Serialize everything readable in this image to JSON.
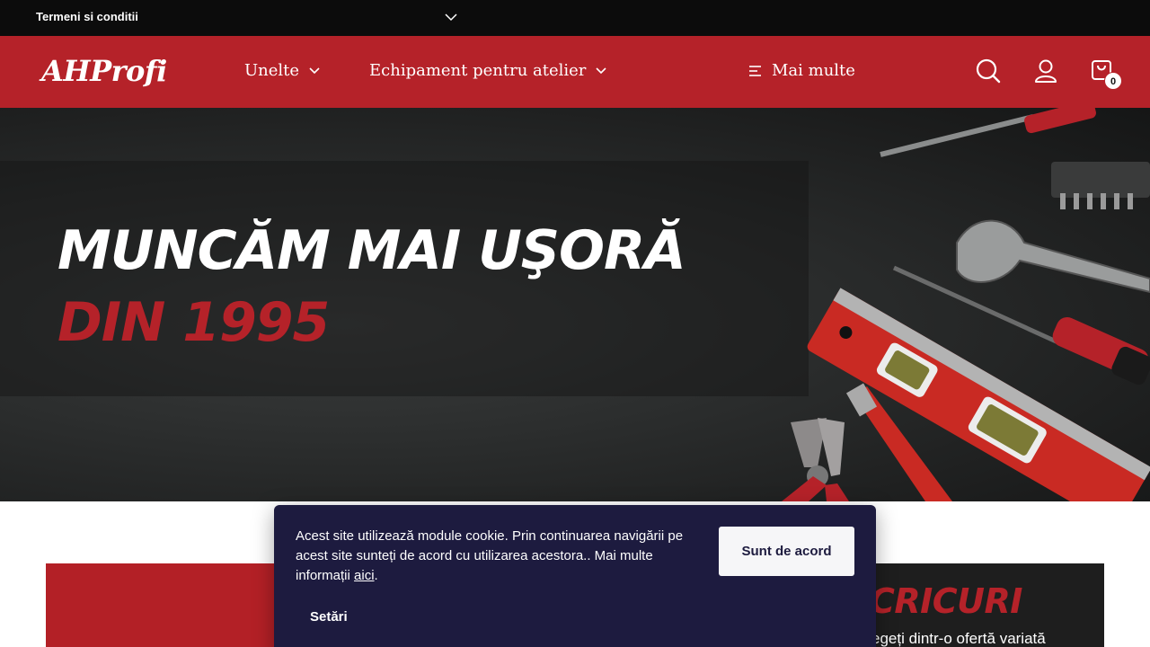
{
  "topbar": {
    "terms_label": "Termeni si conditii"
  },
  "header": {
    "logo": "AHProfi",
    "nav": [
      {
        "label": "Unelte"
      },
      {
        "label": "Echipament pentru atelier"
      },
      {
        "label": "Mai multe"
      }
    ],
    "cart_count": "0"
  },
  "hero": {
    "headline": "MUNCĂM MAI UŞORĂ",
    "subheadline": "DIN 1995"
  },
  "promo_right": {
    "title": "CRICURI",
    "subtitle": "egeți dintr-o ofertă variată"
  },
  "cookie": {
    "message": "Acest site utilizează module cookie. Prin continuarea navigării pe acest site sunteți de acord cu utilizarea acestora.. Mai multe informații",
    "link_label": "aici",
    "agree_label": "Sunt de acord",
    "settings_label": "Setări"
  },
  "colors": {
    "brand_red": "#b52229",
    "topbar_bg": "#0c0c0c",
    "cookie_bg": "#1d1b3f"
  }
}
